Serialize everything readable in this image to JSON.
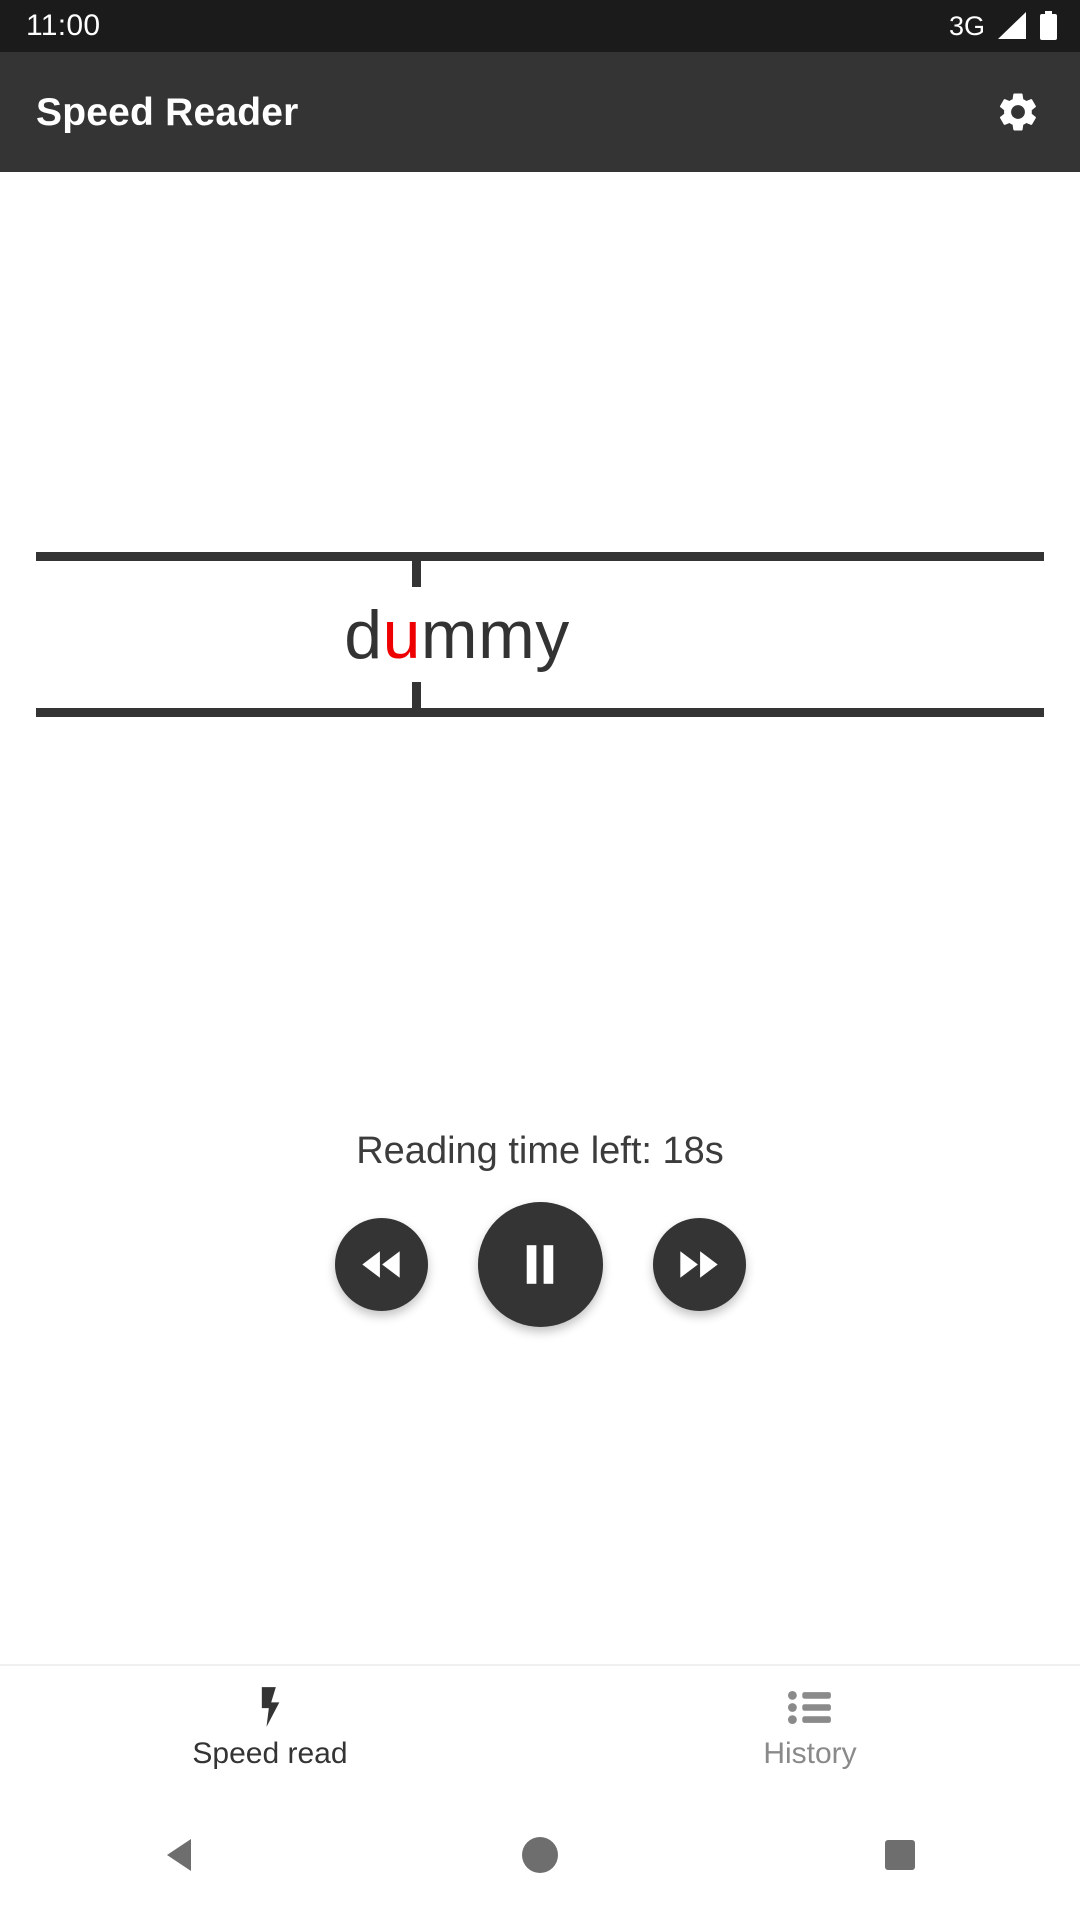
{
  "status_bar": {
    "clock": "11:00",
    "network": "3G",
    "signal_icon": "signal-triangle-icon",
    "battery_icon": "battery-full-icon"
  },
  "app_bar": {
    "title": "Speed Reader",
    "settings_icon": "gear-icon"
  },
  "reader": {
    "word_before": "d",
    "word_focus": "u",
    "word_after": "mmy",
    "full_word": "dummy",
    "focus_color": "#ee0000",
    "text_color": "#333333",
    "guide_color": "#343434"
  },
  "playback": {
    "reading_time_label": "Reading time left: 18s",
    "rewind_icon": "rewind-icon",
    "pause_icon": "pause-icon",
    "forward_icon": "fast-forward-icon",
    "button_color": "#343434"
  },
  "tabs": [
    {
      "label": "Speed read",
      "icon": "lightning-bolt-icon",
      "active": true,
      "color": "#343434"
    },
    {
      "label": "History",
      "icon": "list-icon",
      "active": false,
      "color": "#8a8a8a"
    }
  ],
  "nav_bar": {
    "back_icon": "back-triangle-icon",
    "home_icon": "home-circle-icon",
    "recents_icon": "recents-square-icon",
    "icon_color": "#6e6e6e"
  }
}
